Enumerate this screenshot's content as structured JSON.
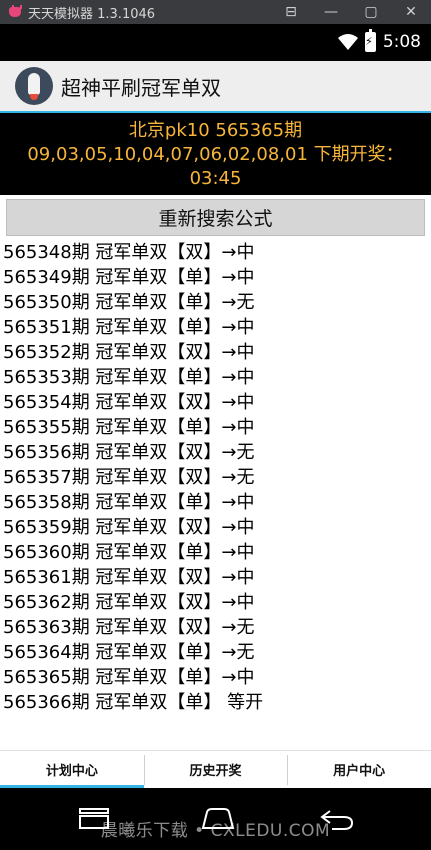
{
  "emulator": {
    "title": "天天模拟器 1.3.1046",
    "controls": [
      "⊟",
      "—",
      "▢",
      "✕"
    ]
  },
  "status": {
    "time": "5:08"
  },
  "app_bar": {
    "title": "超神平刷冠军单双"
  },
  "banner": {
    "line1": "北京pk10 565365期",
    "line2": "09,03,05,10,04,07,06,02,08,01 下期开奖：",
    "line3": "03:45"
  },
  "search_button": {
    "label": "重新搜索公式"
  },
  "records": [
    "565348期 冠军单双【双】→中",
    "565349期 冠军单双【单】→中",
    "565350期 冠军单双【单】→无",
    "565351期 冠军单双【单】→中",
    "565352期 冠军单双【双】→中",
    "565353期 冠军单双【单】→中",
    "565354期 冠军单双【双】→中",
    "565355期 冠军单双【单】→中",
    "565356期 冠军单双【双】→无",
    "565357期 冠军单双【双】→无",
    "565358期 冠军单双【单】→中",
    "565359期 冠军单双【双】→中",
    "565360期 冠军单双【单】→中",
    "565361期 冠军单双【双】→中",
    "565362期 冠军单双【双】→中",
    "565363期 冠军单双【双】→无",
    "565364期 冠军单双【单】→无",
    "565365期 冠军单双【单】→中",
    "565366期 冠军单双【单】 等开"
  ],
  "tabs": [
    {
      "label": "计划中心",
      "active": true
    },
    {
      "label": "历史开奖",
      "active": false
    },
    {
      "label": "用户中心",
      "active": false
    }
  ],
  "watermark": "晨曦乐下载 • CXLEDU.COM",
  "colors": {
    "accent": "#33b5e5",
    "banner_text": "#f6b53a"
  }
}
